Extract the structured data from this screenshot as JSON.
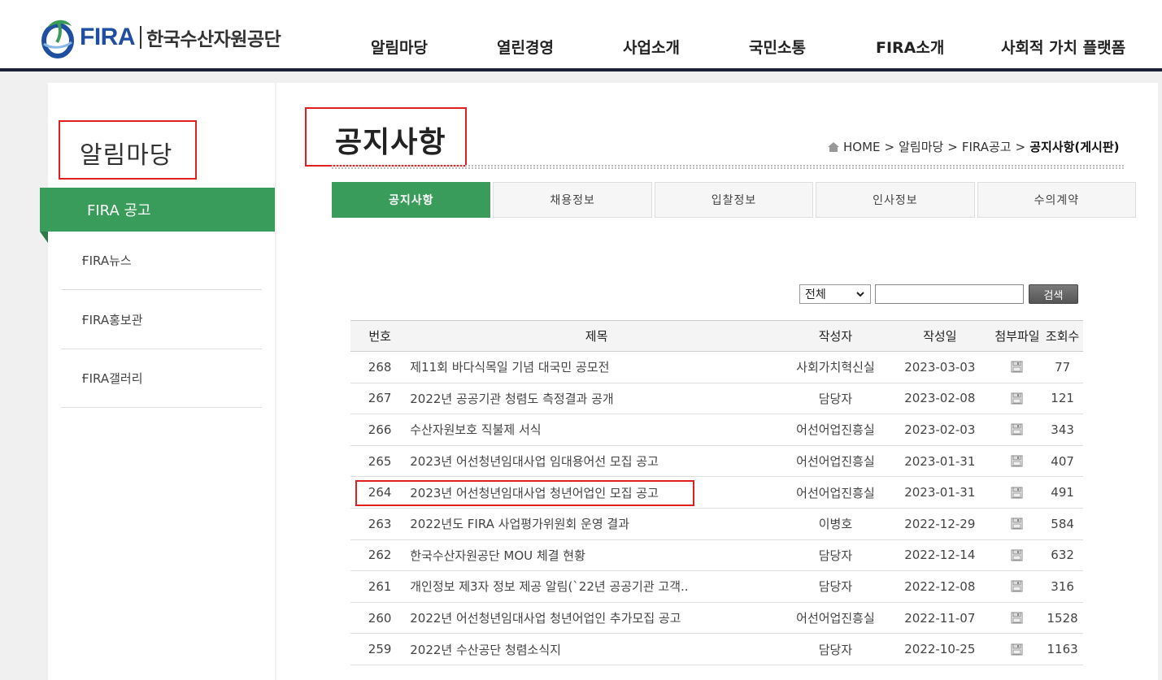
{
  "logo": {
    "en": "FIRA",
    "ko": "한국수산자원공단"
  },
  "gnb": [
    "알림마당",
    "열린경영",
    "사업소개",
    "국민소통",
    "FIRA소개",
    "사회적 가치 플랫폼"
  ],
  "sidebar": {
    "title": "알림마당",
    "active": "FIRA 공고",
    "items": [
      "FIRA뉴스",
      "FIRA홍보관",
      "FIRA갤러리"
    ]
  },
  "page": {
    "title": "공지사항",
    "breadcrumb": [
      "HOME",
      "알림마당",
      "FIRA공고",
      "공지사항(게시판)"
    ]
  },
  "tabs": [
    "공지사항",
    "채용정보",
    "입찰정보",
    "인사정보",
    "수의계약"
  ],
  "search": {
    "select": "전체",
    "button": "검색"
  },
  "table": {
    "headers": [
      "번호",
      "제목",
      "작성자",
      "작성일",
      "첨부파일",
      "조회수"
    ],
    "rows": [
      [
        "268",
        "제11회 바다식목일 기념 대국민 공모전",
        "사회가치혁신실",
        "2023-03-03",
        "77"
      ],
      [
        "267",
        "2022년 공공기관 청렴도 측정결과 공개",
        "담당자",
        "2023-02-08",
        "121"
      ],
      [
        "266",
        "수산자원보호 직불제 서식",
        "어선어업진흥실",
        "2023-02-03",
        "343"
      ],
      [
        "265",
        "2023년 어선청년임대사업 임대용어선 모집 공고",
        "어선어업진흥실",
        "2023-01-31",
        "407"
      ],
      [
        "264",
        "2023년 어선청년임대사업 청년어업인 모집 공고",
        "어선어업진흥실",
        "2023-01-31",
        "491"
      ],
      [
        "263",
        "2022년도 FIRA 사업평가위원회 운영 결과",
        "이병호",
        "2022-12-29",
        "584"
      ],
      [
        "262",
        "한국수산자원공단 MOU 체결 현황",
        "담당자",
        "2022-12-14",
        "632"
      ],
      [
        "261",
        "개인정보 제3자 정보 제공 알림(`22년 공공기관 고객..",
        "담당자",
        "2022-12-08",
        "316"
      ],
      [
        "260",
        "2022년 어선청년임대사업 청년어업인 추가모집 공고",
        "어선어업진흥실",
        "2022-11-07",
        "1528"
      ],
      [
        "259",
        "2022년 수산공단 청렴소식지",
        "담당자",
        "2022-10-25",
        "1163"
      ]
    ]
  }
}
